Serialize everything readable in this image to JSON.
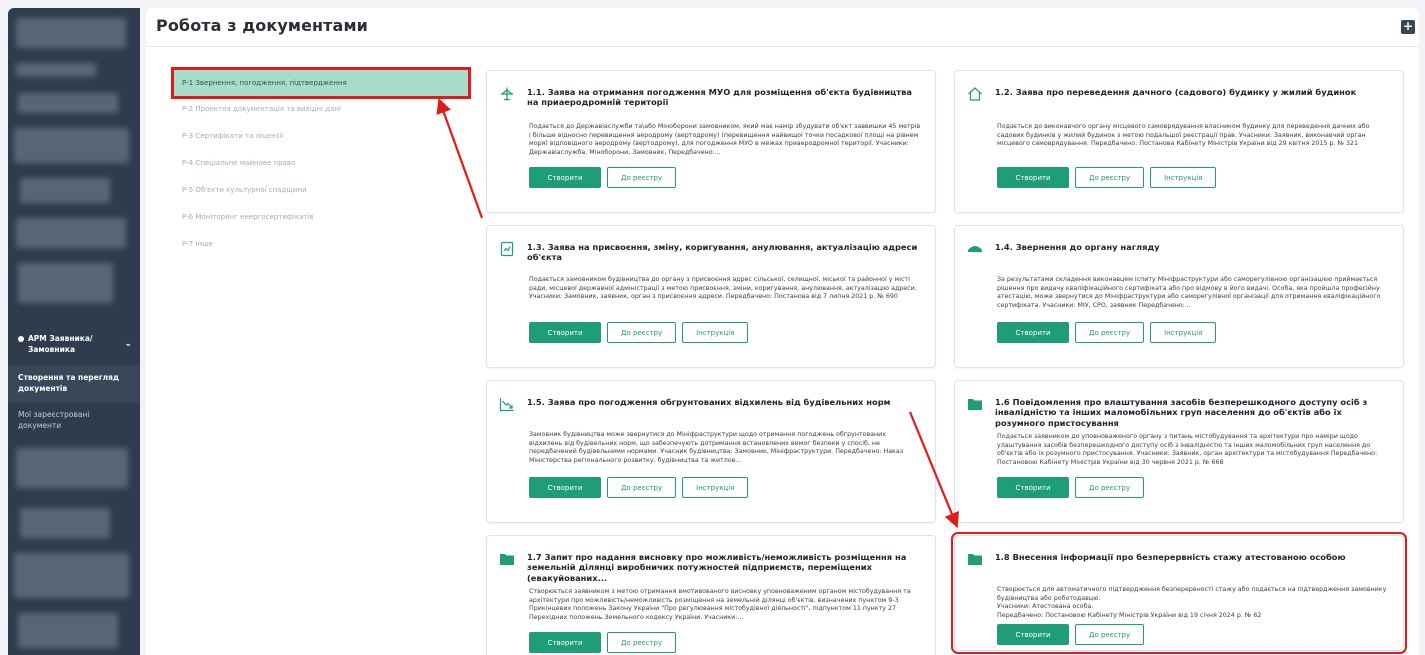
{
  "header": {
    "title": "Робота з документами",
    "add_icon": "add-document-icon"
  },
  "sidebar": {
    "apm": "АРМ Заявника/ Замовника",
    "items": [
      {
        "label": "Створення та перегляд документів",
        "active": true
      },
      {
        "label": "Мої зареєстровані документи",
        "active": false
      }
    ]
  },
  "categories": [
    {
      "label": "Р-1 Звернення, погодження, підтвердження",
      "active": true
    },
    {
      "label": "Р-2 Проектна документація та вихідні дані",
      "active": false
    },
    {
      "label": "Р-3 Сертифікати та ліцензії",
      "active": false
    },
    {
      "label": "Р-4 Спеціальне майнове право",
      "active": false
    },
    {
      "label": "Р-5 Об'єкти культурної спадщини",
      "active": false
    },
    {
      "label": "Р-6 Моніторинг енергосертифікатів",
      "active": false
    },
    {
      "label": "Р-7 Інше",
      "active": false
    }
  ],
  "buttons": {
    "create": "Створити",
    "registry": "До реєстру",
    "instruction": "Інструкція"
  },
  "cards": [
    {
      "icon": "airplane-icon",
      "title": "1.1. Заява на отримання погодження МУО для розміщення об'єкта будівництва на приаеродромній території",
      "description": "Подається до Державіаслужби та\\або Міноборони замовником, який має намір збудувати об'єкт заввишки 45 метрів і більше відносно перевищення аеродрому (вертодрому) (перевищення найвищої точки посадкової площі на рівнем моря) відповідного аеродрому (вертодрому), для погодження МУО в межах приаеродромної території. Учасники: Державіаслужба, Міноборони, Замовник, Передбачено:..."
    },
    {
      "icon": "house-icon",
      "title": "1.2. Заява про переведення дачного (садового) будинку у жилий будинок",
      "description": "Подається до виконавчого органу місцевого самоврядування власником будинку для переведення дачних або садових будинків у жилий будинок з метою подальшої реєстрації прав. Учасники: Заявник, виконавчий орган місцевого самоврядування. Передбачено: Постанова Кабінету Міністрів України від 29 квітня 2015 р. № 321"
    },
    {
      "icon": "map-pin-document-icon",
      "title": "1.3. Заява на присвоєння, зміну, коригування, анулювання, актуалізацію адреси об'єкта",
      "description": "Подається замовником будівництва до органу з присвоєння адрес сільської, селищної, міської та районної у місті ради, місцевої державної адміністрації з метою присвоєння, зміни, коригування, анулювання, актуалізацію адреси. Учасники: Замовник, заявник, орган з присвоєння адреси. Передбачено: Постанова від 7 липня 2021 р. № 690"
    },
    {
      "icon": "inspector-cap-icon",
      "title": "1.4. Звернення до органу нагляду",
      "description": "За результатами складення виконавцем іспиту Мініфраструктури або саморегулівною організацією приймається рішення про видачу кваліфікаційного сертифіката або про відмову в його видачі. Особа, яка пройшла професійну атестацію, може звернутися до Мініфраструктури або саморегулівної організації для отримання кваліфікаційного сертифіката. Учасники: МІУ, СРО, заявник Передбачено:..."
    },
    {
      "icon": "chart-decline-icon",
      "title": "1.5. Заява про погодження обгрунтованих відхилень від будівельних норм",
      "description": "Замовник будівництва може звернутися до Мініфраструктури щодо отримання погоджень обгрунтованих відхилень від будівельних норм, що забезпечують дотримання встановлених вимог безпеки у спосіб, не передбачений будівельними нормами. Учасник будівництва: Замовник, Мініфраструктури. Передбачено: Наказ Міністерства регіонального розвитку, будівництва та житлов..."
    },
    {
      "icon": "folder-icon",
      "title": "1.6 Повідомлення про влаштування засобів безперешкодного доступу осіб з інвалідністю та інших маломобільних груп населення до об'єктів або їх розумного пристосування",
      "description": "Подається заявником до уповноваженого органу з питань містобудування та архітектури про наміри щодо улаштування засобів безперешкодного доступу осіб з інвалідністю та інших маломобільних груп населення до об'єктів або їх розумного пристосування. Учасники: Заявник, орган архітектури та містобудування Передбачено: Постановою Кабінету Міністрів України від 30 червня 2021 р. № 668"
    },
    {
      "icon": "folder-icon",
      "title": "1.7 Запит про надання висновку про можливість/неможливість розміщення на земельній ділянці виробничих потужностей підприємств, переміщених (евакуйованих...",
      "description": "Створюється заявником з метою отримання вмотивованого висновку уповноваженим органом містобудування та архітектури про можливість/неможливість розміщення на земельній ділянці об'єктів, визначених пунктом 9-3 Прикінцевих положень Закону України \"Про регулювання містобудівної діяльності\", підпунктом 11 пункту 27 Перехідних положень Земельного кодексу України. Учасники:..."
    },
    {
      "icon": "folder-icon",
      "title": "1.8 Внесення інформації про безперервність стажу атестованою особою",
      "description": "Створюється для автоматичного підтвердження безперервності стажу або подається на підтвердження замовнику будівництва або роботодавцю.\nУчасники: Атестована особа.\nПередбачено: Постановою Кабінету Міністрів України від 19 січня 2024 р. № 62"
    }
  ]
}
